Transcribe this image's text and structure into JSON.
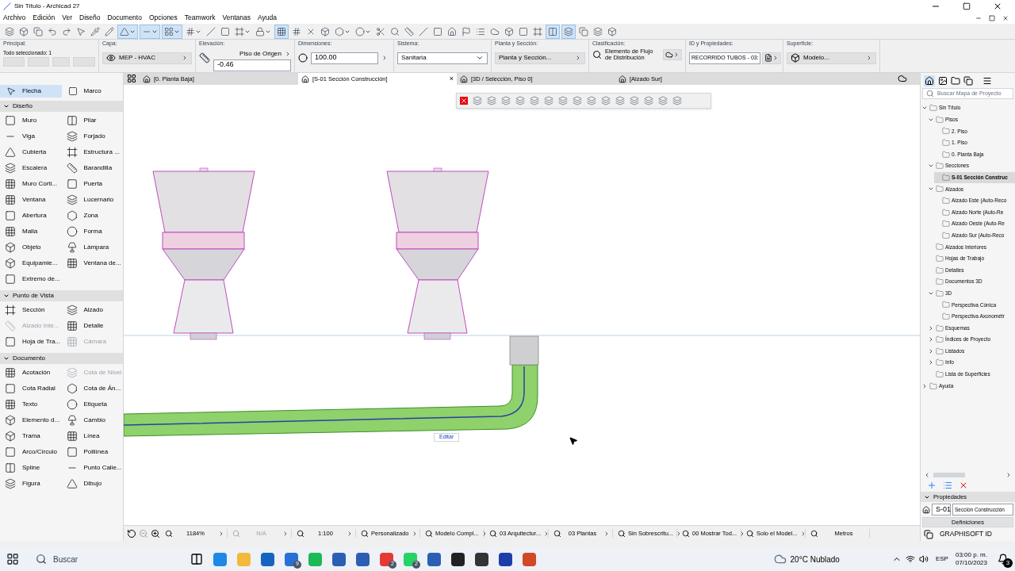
{
  "window": {
    "title": "Sin Título - Archicad 27"
  },
  "menu": [
    "Archivo",
    "Edición",
    "Ver",
    "Diseño",
    "Documento",
    "Opciones",
    "Teamwork",
    "Ventanas",
    "Ayuda"
  ],
  "toolbar": [
    {
      "selected": false,
      "caret": false
    },
    {
      "selected": false,
      "caret": false
    },
    {
      "selected": false,
      "caret": false
    },
    {
      "selected": false,
      "caret": false
    },
    {
      "selected": false,
      "caret": false
    },
    {
      "selected": false,
      "caret": false
    },
    {
      "selected": false,
      "caret": false
    },
    {
      "selected": false,
      "caret": false
    },
    {
      "selected": true,
      "caret": true
    },
    {
      "selected": true,
      "caret": true
    },
    {
      "selected": true,
      "caret": true
    },
    {
      "selected": false,
      "caret": true
    },
    {
      "selected": false,
      "caret": false
    },
    {
      "selected": false,
      "caret": false
    },
    {
      "selected": false,
      "caret": true
    },
    {
      "selected": false,
      "caret": true
    },
    {
      "selected": true,
      "caret": false
    },
    {
      "selected": false,
      "caret": false
    },
    {
      "selected": false,
      "caret": false
    },
    {
      "selected": false,
      "caret": false
    },
    {
      "selected": false,
      "caret": true
    },
    {
      "selected": false,
      "caret": true
    },
    {
      "selected": false,
      "caret": false
    },
    {
      "selected": false,
      "caret": false
    },
    {
      "selected": false,
      "caret": false
    },
    {
      "selected": false,
      "caret": false
    },
    {
      "selected": false,
      "caret": false
    },
    {
      "selected": false,
      "caret": false
    },
    {
      "selected": false,
      "caret": false
    },
    {
      "selected": false,
      "caret": false
    },
    {
      "selected": false,
      "caret": false
    },
    {
      "selected": false,
      "caret": false
    },
    {
      "selected": false,
      "caret": false
    },
    {
      "selected": false,
      "caret": false
    },
    {
      "selected": true,
      "caret": false
    },
    {
      "selected": true,
      "caret": false
    },
    {
      "selected": false,
      "caret": false
    },
    {
      "selected": false,
      "caret": false
    },
    {
      "selected": false,
      "caret": false
    }
  ],
  "info_box": {
    "principal": {
      "label": "Principal:",
      "status": "Todo seleccionado: 1"
    },
    "capa": {
      "label": "Capa:",
      "value": "MEP - HVAC"
    },
    "elevacion": {
      "label": "Elevación:",
      "reference": "Piso de Origen",
      "value": "-0.46"
    },
    "dimensiones": {
      "label": "Dimensiones:",
      "value": "100.00"
    },
    "sistema": {
      "label": "Sistema:",
      "value": "Sanitaria"
    },
    "planta_seccion": {
      "label": "Planta y Sección:",
      "value": "Planta y Sección..."
    },
    "clasificacion": {
      "label": "Clasificación:",
      "value": "Elemento de Flujo de Distribución"
    },
    "id": {
      "label": "ID y Propiedades:",
      "value": "RECORRIDO TUBOS - 03:"
    },
    "superficie": {
      "label": "Superficie:",
      "value": "Modelo..."
    }
  },
  "tabs": [
    {
      "label": "[0. Planta Baja]",
      "selected": false
    },
    {
      "label": "[S-01 Sección Construcción]",
      "selected": true,
      "close": "×"
    },
    {
      "label": "[3D / Selección, Piso 0]",
      "selected": false
    },
    {
      "label": "[Alzado Sur]",
      "selected": false
    }
  ],
  "toolbox": {
    "top": [
      {
        "label": "Flecha",
        "selected": true
      },
      {
        "label": "Marco",
        "selected": false
      }
    ],
    "groups": [
      {
        "title": "Diseño",
        "expanded": true,
        "items": [
          {
            "label": "Muro",
            "disabled": false
          },
          {
            "label": "Pilar",
            "disabled": false
          },
          {
            "label": "Viga",
            "disabled": false
          },
          {
            "label": "Forjado",
            "disabled": false
          },
          {
            "label": "Cubierta",
            "disabled": false
          },
          {
            "label": "Estructura ...",
            "disabled": false
          },
          {
            "label": "Escalera",
            "disabled": false
          },
          {
            "label": "Barandilla",
            "disabled": false
          },
          {
            "label": "Muro Corti...",
            "disabled": false
          },
          {
            "label": "Puerta",
            "disabled": false
          },
          {
            "label": "Ventana",
            "disabled": false
          },
          {
            "label": "Lucernario",
            "disabled": false
          },
          {
            "label": "Abertura",
            "disabled": false
          },
          {
            "label": "Zona",
            "disabled": false
          },
          {
            "label": "Malla",
            "disabled": false
          },
          {
            "label": "Forma",
            "disabled": false
          },
          {
            "label": "Objeto",
            "disabled": false
          },
          {
            "label": "Lámpara",
            "disabled": false
          },
          {
            "label": "Equipamie...",
            "disabled": false
          },
          {
            "label": "Ventana de...",
            "disabled": false
          },
          {
            "label": "Extremo de...",
            "disabled": false
          }
        ]
      },
      {
        "title": "Punto de Vista",
        "expanded": true,
        "items": [
          {
            "label": "Sección",
            "disabled": false
          },
          {
            "label": "Alzado",
            "disabled": false
          },
          {
            "label": "Alzado Inte...",
            "disabled": true
          },
          {
            "label": "Detalle",
            "disabled": false
          },
          {
            "label": "Hoja de Tra...",
            "disabled": false
          },
          {
            "label": "Cámara",
            "disabled": true
          }
        ]
      },
      {
        "title": "Documento",
        "expanded": true,
        "items": [
          {
            "label": "Acotación",
            "disabled": false
          },
          {
            "label": "Cota de Nivel",
            "disabled": true
          },
          {
            "label": "Cota Radial",
            "disabled": false
          },
          {
            "label": "Cota de Án...",
            "disabled": false
          },
          {
            "label": "Texto",
            "disabled": false
          },
          {
            "label": "Etiqueta",
            "disabled": false
          },
          {
            "label": "Elemento d...",
            "disabled": false
          },
          {
            "label": "Cambio",
            "disabled": false
          },
          {
            "label": "Trama",
            "disabled": false
          },
          {
            "label": "Línea",
            "disabled": false
          },
          {
            "label": "Arco/Círculo",
            "disabled": false
          },
          {
            "label": "Polilínea",
            "disabled": false
          },
          {
            "label": "Spline",
            "disabled": false
          },
          {
            "label": "Punto Calie...",
            "disabled": false
          },
          {
            "label": "Figura",
            "disabled": false
          },
          {
            "label": "Dibujo",
            "disabled": false
          }
        ]
      }
    ]
  },
  "canvas": {
    "edit_label": "Editar"
  },
  "navigator": {
    "search": {
      "placeholder": "Buscar Mapa de Proyecto"
    },
    "tree": [
      {
        "label": "Sin Título",
        "expanded": true,
        "selected": false,
        "children": [
          {
            "label": "Pisos",
            "expanded": true,
            "selected": false,
            "children": [
              {
                "label": "2. Piso",
                "selected": false
              },
              {
                "label": "1. Piso",
                "selected": false
              },
              {
                "label": "0. Planta Baja",
                "selected": false
              }
            ]
          },
          {
            "label": "Secciones",
            "expanded": true,
            "selected": false,
            "children": [
              {
                "label": "S-01 Sección Construc",
                "selected": true
              }
            ]
          },
          {
            "label": "Alzados",
            "expanded": true,
            "selected": false,
            "children": [
              {
                "label": "Alzado Este (Auto-Reco",
                "selected": false
              },
              {
                "label": "Alzado Norte (Auto-Re",
                "selected": false
              },
              {
                "label": "Alzado Oeste (Auto-Re",
                "selected": false
              },
              {
                "label": "Alzado Sur (Auto-Reco",
                "selected": false
              }
            ]
          },
          {
            "label": "Alzados Interiores",
            "selected": false
          },
          {
            "label": "Hojas de Trabajo",
            "selected": false
          },
          {
            "label": "Detalles",
            "selected": false
          },
          {
            "label": "Documentos 3D",
            "selected": false
          },
          {
            "label": "3D",
            "expanded": true,
            "selected": false,
            "children": [
              {
                "label": "Perspectiva Cónica",
                "selected": false
              },
              {
                "label": "Perspectiva Axonométr",
                "selected": false
              }
            ]
          },
          {
            "label": "Esquemas",
            "expanded": false,
            "selected": false
          },
          {
            "label": "Índices de Proyecto",
            "expanded": false,
            "selected": false
          },
          {
            "label": "Listados",
            "expanded": false,
            "selected": false
          },
          {
            "label": "Info",
            "expanded": false,
            "selected": false
          },
          {
            "label": "Lista de Superficies",
            "selected": false
          }
        ]
      },
      {
        "label": "Ayuda",
        "expanded": false,
        "selected": false
      }
    ],
    "properties": {
      "title": "Propiedades",
      "id": "S-01",
      "name": "Sección Construcción",
      "button": "Definiciones"
    },
    "account": "GRAPHISOFT ID"
  },
  "status_bar": [
    {
      "value": "1184%",
      "disabled": false
    },
    {
      "value": "N/A",
      "disabled": true
    },
    {
      "value": "1:100",
      "disabled": false
    },
    {
      "value": "Personalizado",
      "disabled": false
    },
    {
      "value": "Modelo Compl...",
      "disabled": false
    },
    {
      "value": "03 Arquitectur...",
      "disabled": false
    },
    {
      "value": "03 Plantas",
      "disabled": false
    },
    {
      "value": "Sin Sobrescritu...",
      "disabled": false
    },
    {
      "value": "00 Mostrar Tod...",
      "disabled": false
    },
    {
      "value": "Solo el Model...",
      "disabled": false
    },
    {
      "value": "Metros",
      "disabled": false
    }
  ],
  "taskbar": {
    "search": {
      "placeholder": "Buscar"
    },
    "apps": [
      {
        "color": "#1e88e5"
      },
      {
        "color": "#f2b93b"
      },
      {
        "color": "#1565c0"
      },
      {
        "color": "#2a6fd6",
        "badge": "9"
      },
      {
        "color": "#1db954"
      },
      {
        "color": "#2b5fb3"
      },
      {
        "color": "#2b5fb3"
      },
      {
        "color": "#e53935",
        "badge": "2"
      },
      {
        "color": "#25d366",
        "badge": "2"
      },
      {
        "color": "#2b5fb3"
      },
      {
        "color": "#222222"
      },
      {
        "color": "#333333"
      },
      {
        "color": "#1a3fa8"
      },
      {
        "color": "#d24726"
      }
    ],
    "weather": "20°C Nublado",
    "language": "ESP",
    "time": "03:00 p. m.",
    "date": "07/10/2023",
    "notifications": "3"
  }
}
